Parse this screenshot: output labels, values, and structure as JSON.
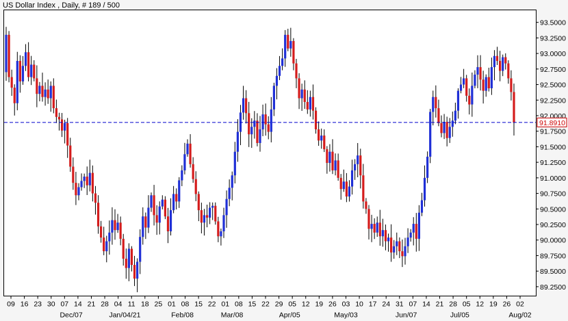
{
  "chart_data": {
    "type": "candlestick",
    "title": "US Dollar Index , Daily, # 189 / 500",
    "ylim": [
      89.1,
      93.7
    ],
    "y_ticks": [
      "93.5000",
      "93.2500",
      "93.0000",
      "92.7500",
      "92.5000",
      "92.2500",
      "92.0000",
      "91.7500",
      "91.5000",
      "91.2500",
      "91.0000",
      "90.7500",
      "90.5000",
      "90.2500",
      "90.0000",
      "89.7500",
      "89.5000",
      "89.2500"
    ],
    "x_ticks": [
      "09",
      "16",
      "23",
      "30",
      "07",
      "14",
      "21",
      "28",
      "04",
      "11",
      "18",
      "25",
      "01",
      "08",
      "15",
      "22",
      "01",
      "08",
      "15",
      "22",
      "29",
      "05",
      "12",
      "19",
      "26",
      "03",
      "10",
      "17",
      "24",
      "31",
      "07",
      "14",
      "21",
      "28",
      "05",
      "12",
      "19",
      "26",
      "02"
    ],
    "months": [
      "Dec/07",
      "Jan/04/21",
      "Feb/08",
      "Mar/08",
      "Apr/05",
      "May/03",
      "Jun/07",
      "Jul/05",
      "Aug/02"
    ],
    "current_price": "91.8910",
    "current_value": 91.891,
    "grid": false,
    "colors": {
      "up": "#1f2fd6",
      "down": "#d41c1c",
      "wick": "#000000",
      "price_line": "#0000cc",
      "price_label": "#cc0000"
    },
    "closes": [
      93.3,
      92.62,
      92.45,
      92.2,
      92.88,
      92.55,
      92.8,
      93.02,
      92.62,
      92.82,
      92.6,
      92.35,
      92.48,
      92.3,
      92.42,
      92.28,
      92.48,
      92.12,
      91.98,
      91.94,
      91.76,
      91.88,
      91.52,
      91.18,
      90.92,
      90.72,
      90.85,
      90.95,
      91.02,
      90.88,
      91.08,
      90.75,
      90.6,
      90.22,
      90.04,
      89.82,
      89.98,
      90.12,
      90.32,
      90.16,
      90.28,
      90.02,
      89.7,
      89.55,
      89.86,
      89.6,
      89.38,
      89.65,
      90.05,
      90.38,
      90.2,
      90.52,
      90.72,
      90.4,
      90.28,
      90.54,
      90.65,
      90.38,
      90.14,
      90.48,
      90.74,
      90.62,
      90.96,
      91.12,
      91.38,
      91.55,
      91.22,
      90.98,
      90.74,
      90.48,
      90.28,
      90.4,
      90.36,
      90.52,
      90.55,
      90.3,
      90.06,
      90.14,
      90.4,
      90.66,
      90.84,
      91.04,
      91.42,
      91.74,
      92.05,
      92.28,
      92.04,
      91.7,
      91.82,
      91.92,
      91.56,
      91.78,
      92.02,
      91.86,
      91.74,
      92.1,
      92.48,
      92.64,
      92.8,
      92.92,
      93.3,
      93.08,
      93.2,
      92.84,
      92.6,
      92.28,
      92.42,
      92.22,
      92.1,
      92.3,
      92.08,
      91.78,
      91.6,
      91.68,
      91.46,
      91.24,
      91.42,
      91.12,
      91.28,
      91.0,
      90.82,
      90.94,
      90.7,
      90.86,
      91.12,
      91.22,
      91.36,
      91.04,
      90.62,
      90.5,
      90.18,
      90.26,
      90.12,
      90.28,
      90.06,
      90.16,
      89.98,
      90.04,
      89.8,
      89.9,
      89.98,
      89.82,
      89.74,
      89.9,
      90.04,
      90.12,
      90.26,
      90.02,
      90.44,
      90.64,
      91.0,
      91.34,
      92.06,
      92.3,
      92.12,
      91.88,
      91.72,
      91.9,
      91.64,
      91.82,
      91.92,
      92.08,
      92.4,
      92.5,
      92.6,
      92.32,
      92.18,
      92.48,
      92.66,
      92.78,
      92.58,
      92.4,
      92.62,
      92.44,
      92.78,
      92.96,
      92.88,
      92.72,
      92.94,
      92.84,
      92.6,
      92.38,
      91.89
    ],
    "opens": [
      92.7,
      93.3,
      92.62,
      92.45,
      92.2,
      92.88,
      92.55,
      92.8,
      93.02,
      92.62,
      92.82,
      92.6,
      92.35,
      92.48,
      92.3,
      92.42,
      92.28,
      92.48,
      92.12,
      91.98,
      91.94,
      91.76,
      91.88,
      91.52,
      91.18,
      90.92,
      90.72,
      90.85,
      90.95,
      91.02,
      90.88,
      91.08,
      90.75,
      90.6,
      90.22,
      90.04,
      89.82,
      89.98,
      90.12,
      90.32,
      90.16,
      90.28,
      90.02,
      89.7,
      89.55,
      89.86,
      89.6,
      89.38,
      89.65,
      90.05,
      90.38,
      90.2,
      90.52,
      90.72,
      90.4,
      90.28,
      90.54,
      90.65,
      90.38,
      90.14,
      90.48,
      90.74,
      90.62,
      90.96,
      91.12,
      91.38,
      91.55,
      91.22,
      90.98,
      90.74,
      90.48,
      90.28,
      90.4,
      90.36,
      90.52,
      90.55,
      90.3,
      90.06,
      90.14,
      90.4,
      90.66,
      90.84,
      91.04,
      91.42,
      91.74,
      92.05,
      92.28,
      92.04,
      91.7,
      91.82,
      91.92,
      91.56,
      91.78,
      92.02,
      91.86,
      91.74,
      92.1,
      92.48,
      92.64,
      92.8,
      92.92,
      93.3,
      93.08,
      93.2,
      92.84,
      92.6,
      92.28,
      92.42,
      92.22,
      92.1,
      92.3,
      92.08,
      91.78,
      91.6,
      91.68,
      91.46,
      91.24,
      91.42,
      91.12,
      91.28,
      91.0,
      90.82,
      90.94,
      90.7,
      90.86,
      91.12,
      91.22,
      91.36,
      91.04,
      90.62,
      90.5,
      90.18,
      90.26,
      90.12,
      90.28,
      90.06,
      90.16,
      89.98,
      90.04,
      89.8,
      89.9,
      89.98,
      89.82,
      89.74,
      89.9,
      90.04,
      90.12,
      90.26,
      90.02,
      90.44,
      90.64,
      91.0,
      91.34,
      92.06,
      92.3,
      92.12,
      91.88,
      91.72,
      91.9,
      91.64,
      91.82,
      91.92,
      92.08,
      92.4,
      92.5,
      92.6,
      92.32,
      92.18,
      92.48,
      92.66,
      92.78,
      92.58,
      92.4,
      92.62,
      92.44,
      92.78,
      92.96,
      92.88,
      92.72,
      92.94,
      92.84,
      92.6,
      92.38
    ]
  }
}
